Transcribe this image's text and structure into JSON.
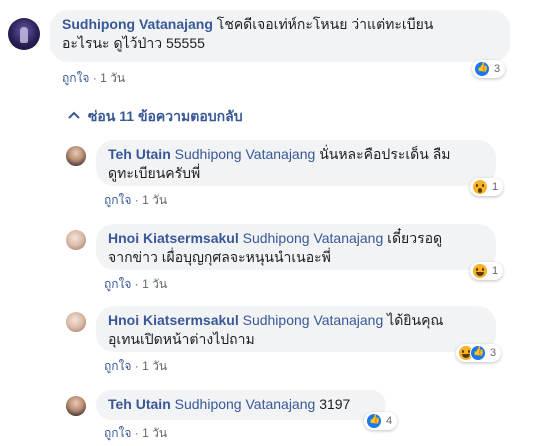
{
  "main_comment": {
    "author": "Sudhipong Vatanajang",
    "text_line1": "โชคดีเจอเท่ห์กะโหนย ว่าแต่ทะเบียน",
    "text_line2": "อะไรนะ ดูไว้ป่าว 55555",
    "like_label": "ถูกใจ",
    "time": "1 วัน",
    "reaction_count": "3",
    "reaction_icons": [
      "like-icon"
    ]
  },
  "replies_toggle": {
    "label": "ซ่อน 11 ข้อความตอบกลับ",
    "icon": "reply-arrow-icon"
  },
  "replies": [
    {
      "author": "Teh Utain",
      "mention": "Sudhipong Vatanajang",
      "text_line1": "นั่นหละคือประเด็น ลืม",
      "text_line2": "ดูทะเบียนครับพี่",
      "like_label": "ถูกใจ",
      "time": "1 วัน",
      "reaction_count": "1",
      "reaction_icons": [
        "wow-icon"
      ]
    },
    {
      "author": "Hnoi Kiatsermsakul",
      "mention": "Sudhipong Vatanajang",
      "text_line1": "เดี๋ยวรอดู",
      "text_line2": "จากข่าว เผื่อบุญกุศลจะหนุนนำเนอะพี่",
      "like_label": "ถูกใจ",
      "time": "1 วัน",
      "reaction_count": "1",
      "reaction_icons": [
        "haha-icon"
      ]
    },
    {
      "author": "Hnoi Kiatsermsakul",
      "mention": "Sudhipong Vatanajang",
      "text_line1": "ได้ยินคุณ",
      "text_line2": "อุเทนเปิดหน้าต่างไปถาม",
      "like_label": "ถูกใจ",
      "time": "1 วัน",
      "reaction_count": "3",
      "reaction_icons": [
        "haha-icon",
        "like-icon"
      ]
    },
    {
      "author": "Teh Utain",
      "mention": "Sudhipong Vatanajang",
      "text_line1": "3197",
      "like_label": "ถูกใจ",
      "time": "1 วัน",
      "reaction_count": "4",
      "reaction_icons": [
        "like-icon"
      ]
    }
  ],
  "colors": {
    "link": "#385898",
    "bubble": "#f2f3f5",
    "meta": "#606770",
    "like": "#1877f2",
    "emoji": "#f7b125"
  }
}
